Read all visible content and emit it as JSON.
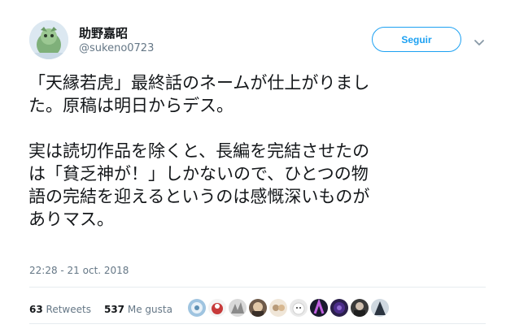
{
  "author": {
    "display_name": "助野嘉昭",
    "handle": "@sukeno0723"
  },
  "follow_button": {
    "label": "Seguir"
  },
  "tweet": {
    "text": "「天縁若虎」最終話のネームが仕上がりまし\nた。原稿は明日からデス。\n\n実は読切作品を除くと、長編を完結させたの\nは「貧乏神が！」しかないので、ひとつの物\n語の完結を迎えるというのは感慨深いものが\nありマス。",
    "timestamp": "22:28 - 21 oct. 2018"
  },
  "stats": {
    "retweets_count": "63",
    "retweets_label": "Retweets",
    "likes_count": "537",
    "likes_label": "Me gusta"
  },
  "colors": {
    "accent": "#1da1f2",
    "secondary_text": "#657786",
    "primary_text": "#14171a",
    "divider": "#e6ecf0"
  },
  "icons": {
    "menu": "chevron-down-icon"
  }
}
